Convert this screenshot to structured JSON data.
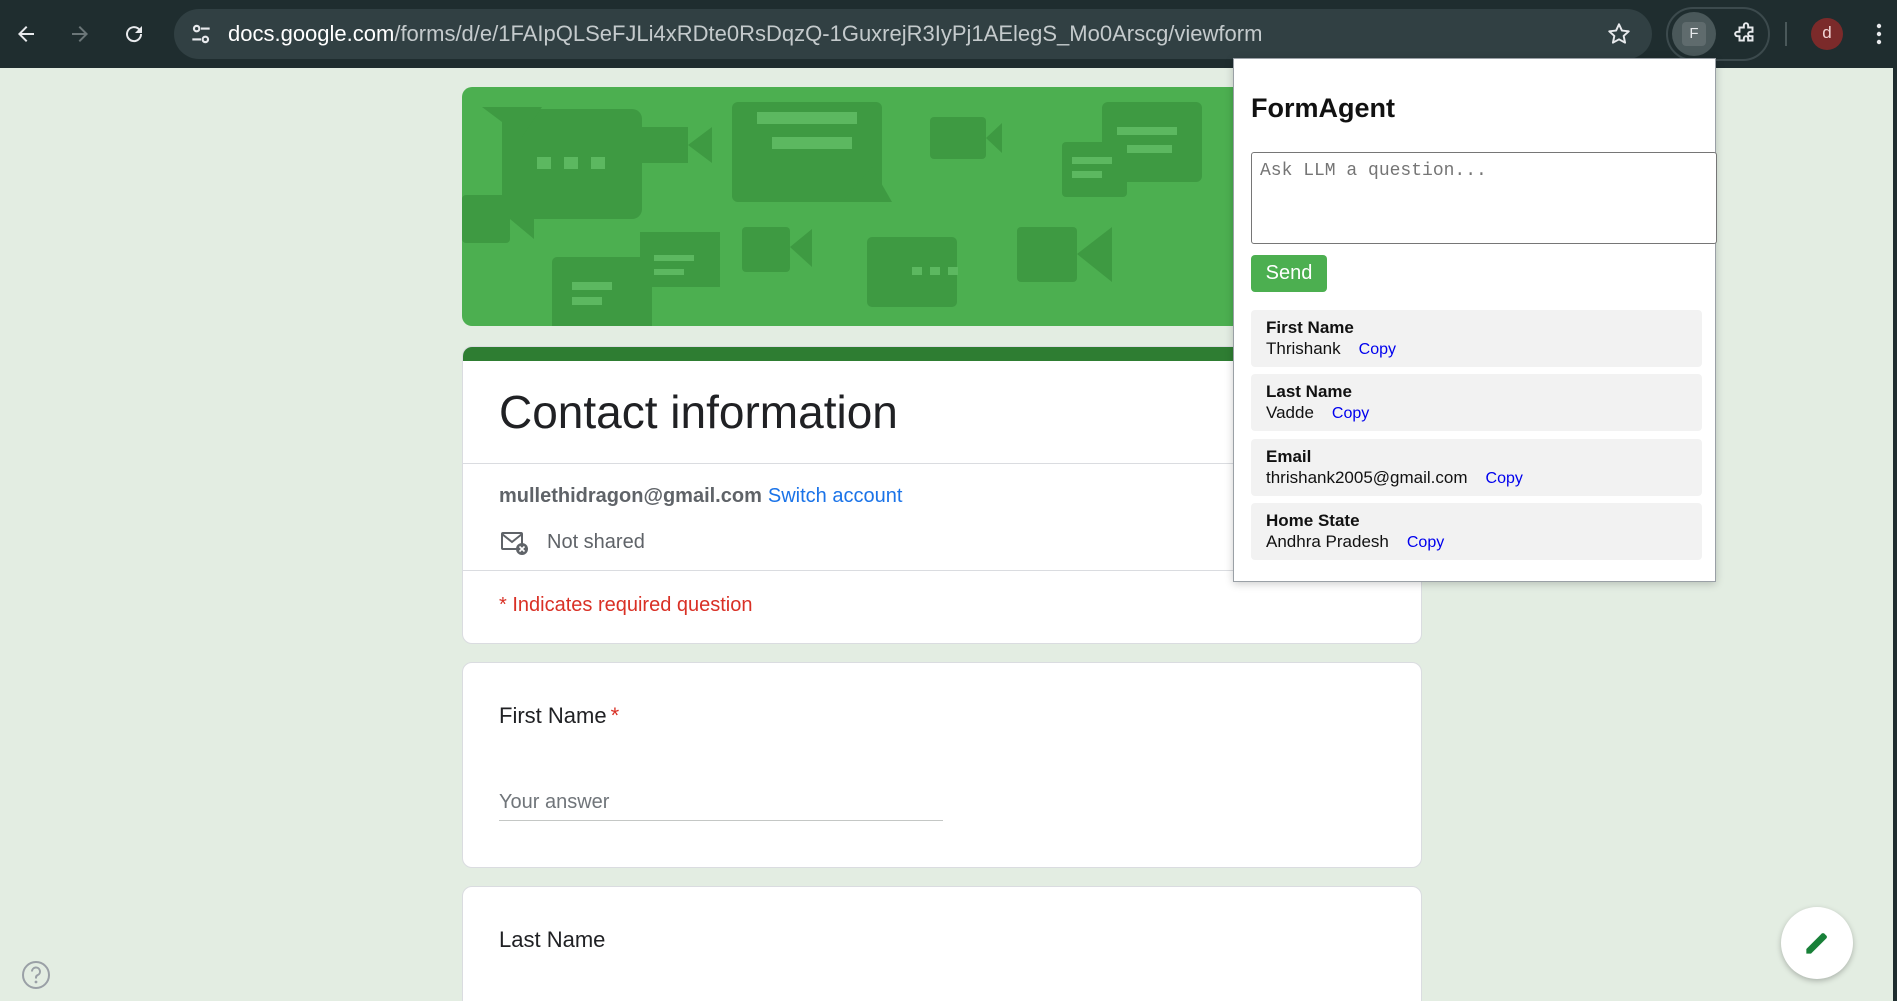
{
  "browser": {
    "url_host": "docs.google.com",
    "url_path": "/forms/d/e/1FAIpQLSeFJLi4xRDte0RsDqzQ-1GuxrejR3IyPj1AElegS_Mo0Arscg/viewform",
    "extension_letter": "F",
    "profile_letter": "d"
  },
  "form": {
    "title": "Contact information",
    "account_email": "mullethidragon@gmail.com",
    "switch_account": "Switch account",
    "not_shared": "Not shared",
    "required_note": "* Indicates required question",
    "questions": [
      {
        "label": "First Name",
        "required_mark": "*",
        "placeholder": "Your answer"
      },
      {
        "label": "Last Name"
      }
    ],
    "accent_color": "#2e7d32"
  },
  "popup": {
    "title": "FormAgent",
    "ask_placeholder": "Ask LLM a question...",
    "send_label": "Send",
    "copy_label": "Copy",
    "items": [
      {
        "label": "First Name",
        "value": "Thrishank"
      },
      {
        "label": "Last Name",
        "value": "Vadde"
      },
      {
        "label": "Email",
        "value": "thrishank2005@gmail.com"
      },
      {
        "label": "Home State",
        "value": "Andhra Pradesh"
      }
    ],
    "send_color": "#4caf50"
  }
}
